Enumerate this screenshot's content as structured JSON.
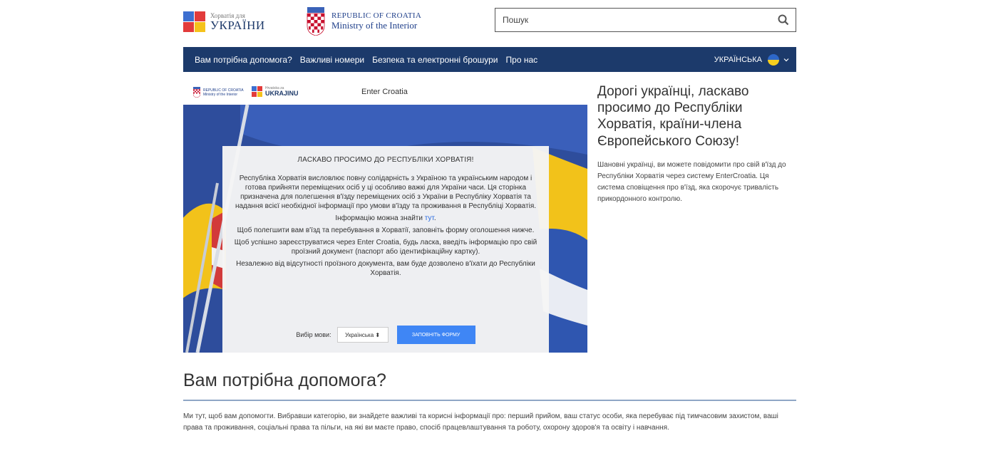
{
  "header": {
    "ua_logo_small": "Хорватія для",
    "ua_logo_big": "УКРАЇНИ",
    "mi_logo_line1": "REPUBLIC OF CROATIA",
    "mi_logo_line2": "Ministry of the Interior",
    "search_placeholder": "Пошук"
  },
  "nav": {
    "items": [
      {
        "label": "Вам потрібна допомога?"
      },
      {
        "label": "Важливі номери"
      },
      {
        "label": "Безпека та електронні брошури"
      },
      {
        "label": "Про нас"
      }
    ],
    "language": "УКРАЇНСЬКА",
    "flag_colors": [
      "#2d67c8",
      "#f7cf1e"
    ],
    "bar_color": "#1c3a6b"
  },
  "embed": {
    "mini_mi_text": "REPUBLIC OF CROATIA Ministry of the Interior",
    "mini_ua_small": "Hrvatska za",
    "mini_ua_big": "UKRAJINU",
    "enter_croatia": "Enter Croatia",
    "card_title": "ЛАСКАВО ПРОСИМО ДО РЕСПУБЛІКИ ХОРВАТІЯ!",
    "paragraphs": [
      "Республіка Хорватія висловлює повну солідарність з Україною та українським народом і готова прийняти переміщених осіб у ці особливо важкі для України часи. Ця сторінка призначена для полегшення в'їзду переміщених осіб з України в Республіку Хорватія та надання всієї необхідної інформації про умови в'їзду та проживання в Республіці Хорватія."
    ],
    "info_prefix": "Інформацію можна знайти ",
    "info_link": "тут",
    "info_suffix": ".",
    "p3": "Щоб полегшити вам в'їзд та перебування в Хорватії, заповніть форму оголошення нижче.",
    "p4": "Щоб успішно зареєструватися через Enter Croatia, будь ласка, введіть інформацію про свій проїзний документ (паспорт або ідентифікаційну картку).",
    "p5": "Незалежно від відсутності проїзного документа, вам буде дозволено в'їхати до Республіки Хорватія.",
    "lang_label": "Вибір мови:",
    "lang_value": "Українська ⬍",
    "fill_button": "ЗАПОВНІТЬ ФОРМУ"
  },
  "aside": {
    "title": "Дорогі українці, ласкаво просимо до Республіки Хорватія, країни-члена Європейського Союзу!",
    "text": "Шановні українці, ви можете повідомити про свій в'їзд до Республіки Хорватія через систему EnterCroatia. Ця система сповіщення про в'їзд, яка скорочує тривалість прикордонного контролю."
  },
  "help": {
    "title": "Вам потрібна допомога?",
    "text": "Ми тут, щоб вам допомогти. Вибравши категорію, ви знайдете важливі та корисні інформації про: перший прийом, ваш статус особи, яка перебуває під тимчасовим захистом, ваші права та проживання, соціальні права та пільги, на які ви маєте право, спосіб працевлаштування та роботу, охорону здоров'я та освіту і навчання."
  }
}
